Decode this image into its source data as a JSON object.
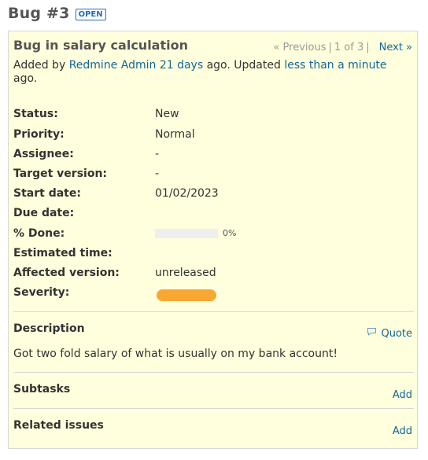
{
  "issue": {
    "title": "Bug #3",
    "status_badge": "OPEN",
    "subject": "Bug in salary calculation",
    "pager": {
      "previous": "« Previous",
      "separator": "|",
      "position": "1 of 3",
      "next": "Next »"
    },
    "author_line": {
      "prefix": "Added by",
      "author": "Redmine Admin",
      "created_ago": "21 days",
      "middle": "ago. Updated",
      "updated_ago": "less than a minute",
      "suffix": "ago."
    }
  },
  "attributes": [
    {
      "label": "Status:",
      "value": "New",
      "kind": "text"
    },
    {
      "label": "Priority:",
      "value": "Normal",
      "kind": "text"
    },
    {
      "label": "Assignee:",
      "value": "-",
      "kind": "text"
    },
    {
      "label": "Target version:",
      "value": "-",
      "kind": "text"
    },
    {
      "label": "Start date:",
      "value": "01/02/2023",
      "kind": "text"
    },
    {
      "label": "Due date:",
      "value": "",
      "kind": "text"
    },
    {
      "label": "% Done:",
      "value": "0%",
      "kind": "progress",
      "percent": 0
    },
    {
      "label": "Estimated time:",
      "value": "",
      "kind": "text"
    },
    {
      "label": "Affected version:",
      "value": "unreleased",
      "kind": "link"
    },
    {
      "label": "Severity:",
      "value": "",
      "kind": "color",
      "color": "#f8a732"
    }
  ],
  "description": {
    "title": "Description",
    "quote_label": "Quote",
    "text": "Got two fold salary of what is usually on my bank account!"
  },
  "subtasks": {
    "title": "Subtasks",
    "add_label": "Add"
  },
  "related": {
    "title": "Related issues",
    "add_label": "Add"
  },
  "colors": {
    "box_background": "#ffffdd",
    "link": "#116699",
    "badge": "#2b6cb0",
    "severity": "#f8a732"
  }
}
